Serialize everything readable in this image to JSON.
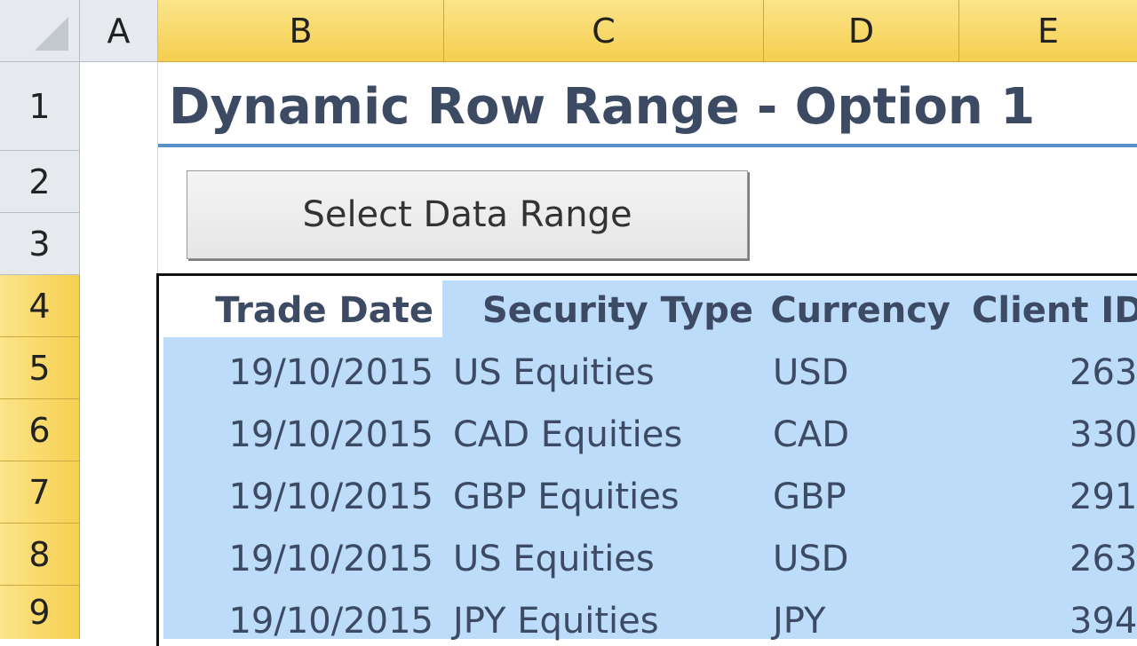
{
  "columns": [
    "A",
    "B",
    "C",
    "D",
    "E"
  ],
  "rows": [
    "1",
    "2",
    "3",
    "4",
    "5",
    "6",
    "7",
    "8",
    "9"
  ],
  "title": "Dynamic Row Range - Option 1",
  "button_label": "Select Data Range",
  "table": {
    "headers": [
      "Trade Date",
      "Security Type",
      "Currency",
      "Client ID"
    ],
    "rows": [
      [
        "19/10/2015",
        "US Equities",
        "USD",
        "263"
      ],
      [
        "19/10/2015",
        "CAD Equities",
        "CAD",
        "330"
      ],
      [
        "19/10/2015",
        "GBP Equities",
        "GBP",
        "291"
      ],
      [
        "19/10/2015",
        "US Equities",
        "USD",
        "263"
      ],
      [
        "19/10/2015",
        "JPY Equities",
        "JPY",
        "394"
      ]
    ]
  },
  "colors": {
    "header_selected": "#f6cf4f",
    "selection": "#bcdcf9",
    "title": "#3c4a63",
    "title_rule": "#5b8fc8"
  }
}
